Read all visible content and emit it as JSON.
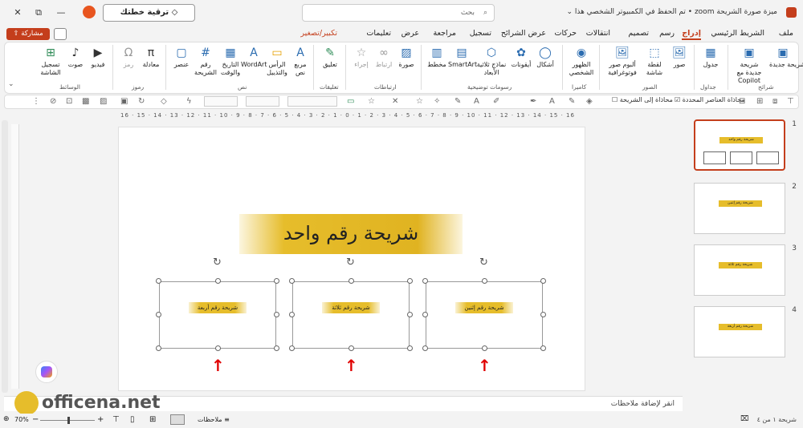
{
  "titlebar": {
    "doc_title": "ميزة صورة الشريحة zoom • تم الحفظ في الكمبيوتر الشخصي هذا ⌄",
    "search_placeholder": "بحث",
    "upgrade_label": "ترقية خطتك",
    "minimize": "—",
    "restore": "⧉",
    "close": "✕"
  },
  "tabs": [
    "ملف",
    "الشريط الرئيسي",
    "إدراج",
    "رسم",
    "تصميم",
    "انتقالات",
    "حركات",
    "عرض الشرائح",
    "تسجيل",
    "مراجعة",
    "عرض",
    "تعليمات",
    "تكبير/تصغير"
  ],
  "share_label": "مشاركة",
  "ribbon": {
    "buttons": [
      {
        "label": "شريحة جديدة",
        "icon": "new-slide-icon",
        "glyph": "▣"
      },
      {
        "label": "شريحة جديدة مع Copilot",
        "icon": "copilot-slide-icon",
        "glyph": "▣"
      },
      {
        "label": "جدول",
        "icon": "table-icon",
        "glyph": "▦"
      },
      {
        "label": "صور",
        "icon": "pictures-icon",
        "glyph": "🖼"
      },
      {
        "label": "لقطة شاشة",
        "icon": "screenshot-icon",
        "glyph": "⬚"
      },
      {
        "label": "ألبوم صور فوتوغرافية",
        "icon": "photo-album-icon",
        "glyph": "🖼"
      },
      {
        "label": "الظهور الشخصي",
        "icon": "cameo-icon",
        "glyph": "◉"
      },
      {
        "label": "أشكال",
        "icon": "shapes-icon",
        "glyph": "◯"
      },
      {
        "label": "أيقونات",
        "icon": "icons-icon",
        "glyph": "✿"
      },
      {
        "label": "نماذج ثلاثية الأبعاد",
        "icon": "3d-models-icon",
        "glyph": "⬡"
      },
      {
        "label": "SmartArt",
        "icon": "smartart-icon",
        "glyph": "▤"
      },
      {
        "label": "مخطط",
        "icon": "chart-icon",
        "glyph": "▥"
      },
      {
        "label": "صورة",
        "icon": "zoom-icon",
        "glyph": "▨"
      },
      {
        "label": "ارتباط",
        "icon": "link-icon",
        "glyph": "∞"
      },
      {
        "label": "إجراء",
        "icon": "action-icon",
        "glyph": "☆"
      },
      {
        "label": "تعليق",
        "icon": "comment-icon",
        "glyph": "✎"
      },
      {
        "label": "مربع نص",
        "icon": "textbox-icon",
        "glyph": "A"
      },
      {
        "label": "الرأس والتذييل",
        "icon": "header-footer-icon",
        "glyph": "▭"
      },
      {
        "label": "WordArt",
        "icon": "wordart-icon",
        "glyph": "A"
      },
      {
        "label": "التاريخ والوقت",
        "icon": "date-time-icon",
        "glyph": "▦"
      },
      {
        "label": "رقم الشريحة",
        "icon": "slide-number-icon",
        "glyph": "#"
      },
      {
        "label": "عنصر",
        "icon": "object-icon",
        "glyph": "▢"
      },
      {
        "label": "معادلة",
        "icon": "equation-icon",
        "glyph": "π"
      },
      {
        "label": "رمز",
        "icon": "symbol-icon",
        "glyph": "Ω"
      },
      {
        "label": "فيديو",
        "icon": "video-icon",
        "glyph": "▶"
      },
      {
        "label": "صوت",
        "icon": "audio-icon",
        "glyph": "♪"
      },
      {
        "label": "تسجيل الشاشة",
        "icon": "screen-record-icon",
        "glyph": "⊞"
      }
    ],
    "groups": [
      "شرائح",
      "جداول",
      "الصور",
      "كاميرا",
      "رسومات توضيحية",
      "ارتباطات",
      "تعليقات",
      "نص",
      "رموز",
      "الوسائط"
    ]
  },
  "format_bar": {
    "fit_slide": "محاذاة إلى الشريحة",
    "align_selected": "محاذاة العناصر المحددة"
  },
  "ruler_text": "16 · 15 · 14 · 13 · 12 · 11 · 10 · 9 · 8 · 7 · 6 · 5 · 4 · 3 · 2 · 1 · 0 · 1 · 2 · 3 · 4 · 5 · 6 · 7 · 8 · 9 · 10 · 11 · 12 · 13 · 14 · 15 · 16",
  "slide": {
    "title": "شريحة رقم واحد",
    "boxes": [
      "شريحة رقم أربعة",
      "شريحة رقم ثلاثة",
      "شريحة رقم إثنين"
    ]
  },
  "thumbnails": [
    {
      "num": "1",
      "label": "شريحة رقم واحد"
    },
    {
      "num": "2",
      "label": "شريحة رقم إثنين"
    },
    {
      "num": "3",
      "label": "شريحة رقم ثلاثة"
    },
    {
      "num": "4",
      "label": "شريحة رقم أربعة"
    }
  ],
  "notes_placeholder": "انقر لإضافة ملاحظات",
  "status": {
    "slide_info": "شريحة ١ من ٤",
    "notes_label": "ملاحظات",
    "zoom": "70%"
  },
  "watermark": "officena.net",
  "colors": {
    "accent": "#c43e1c",
    "gold": "#e6bd2b",
    "arrow": "#e00000"
  }
}
